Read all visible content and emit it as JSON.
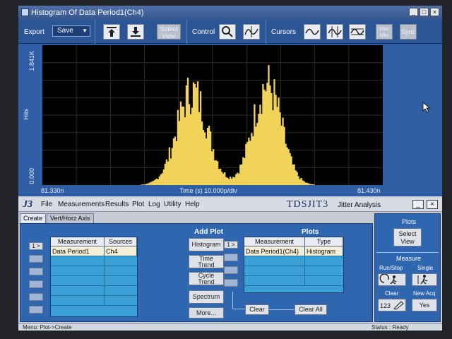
{
  "plot_window": {
    "title": "Histogram Of Data Period1(Ch4)",
    "toolbar": {
      "export_label": "Export",
      "save_value": "Save",
      "select_view_label": "Select View",
      "control_label": "Control",
      "cursors_label": "Cursors",
      "disabled_1": "Wav Mks",
      "disabled_2": "Sync"
    },
    "y_top_label": "1.841K",
    "y_axis_label": "Hits",
    "y_bottom_label": "0.000",
    "x_left_label": "81.330n",
    "x_center_label": "Time (s)   10.000p/div",
    "x_right_label": "81.430n",
    "colors": {
      "histogram": "#f2d35a",
      "background": "#000000",
      "grid": "#2b2b2b"
    }
  },
  "chart_data": {
    "type": "histogram",
    "title": "Histogram Of Data Period1(Ch4)",
    "xlabel": "Time (s)",
    "ylabel": "Hits",
    "xlim": [
      81.33,
      81.43
    ],
    "ylim": [
      0,
      1841
    ],
    "x_unit": "ns",
    "x_scale": "10.000p/div",
    "grid": true,
    "peaks": [
      {
        "center_ns": 81.374,
        "height": 1230,
        "sigma_ns": 0.0045
      },
      {
        "center_ns": 81.396,
        "height": 1320,
        "sigma_ns": 0.0042
      }
    ]
  },
  "app": {
    "logo": "J3",
    "menu": [
      "File",
      "Measurements",
      "Results",
      "Plot",
      "Log",
      "Utility",
      "Help"
    ],
    "brand": "TDSJIT3",
    "brand_sub": "Jitter Analysis",
    "tabs": [
      "Create",
      "Vert/Horz Axis"
    ],
    "measurements_table": {
      "headers": [
        "Measurement",
        "Sources"
      ],
      "rows": [
        [
          "Data Period1",
          "Ch4"
        ]
      ]
    },
    "add_plot": {
      "title": "Add Plot",
      "buttons": [
        "Histogram",
        "Time Trend",
        "Cycle Trend",
        "Spectrum",
        "More..."
      ]
    },
    "plots": {
      "title": "Plots",
      "headers": [
        "Measurement",
        "Type"
      ],
      "rows": [
        [
          "Data Period1(Ch4)",
          "Histogram"
        ]
      ],
      "clear_label": "Clear",
      "clear_all_label": "Clear All",
      "side_button_label": "1 >"
    },
    "right": {
      "plots_label": "Plots",
      "select_view": "Select View",
      "measure_label": "Measure",
      "run_stop": "Run/Stop",
      "single": "Single",
      "clear": "Clear",
      "new_acq": "New Acq",
      "yes": "Yes"
    },
    "status_left": "Menu: Plot->Create",
    "status_right": "Status : Ready"
  }
}
